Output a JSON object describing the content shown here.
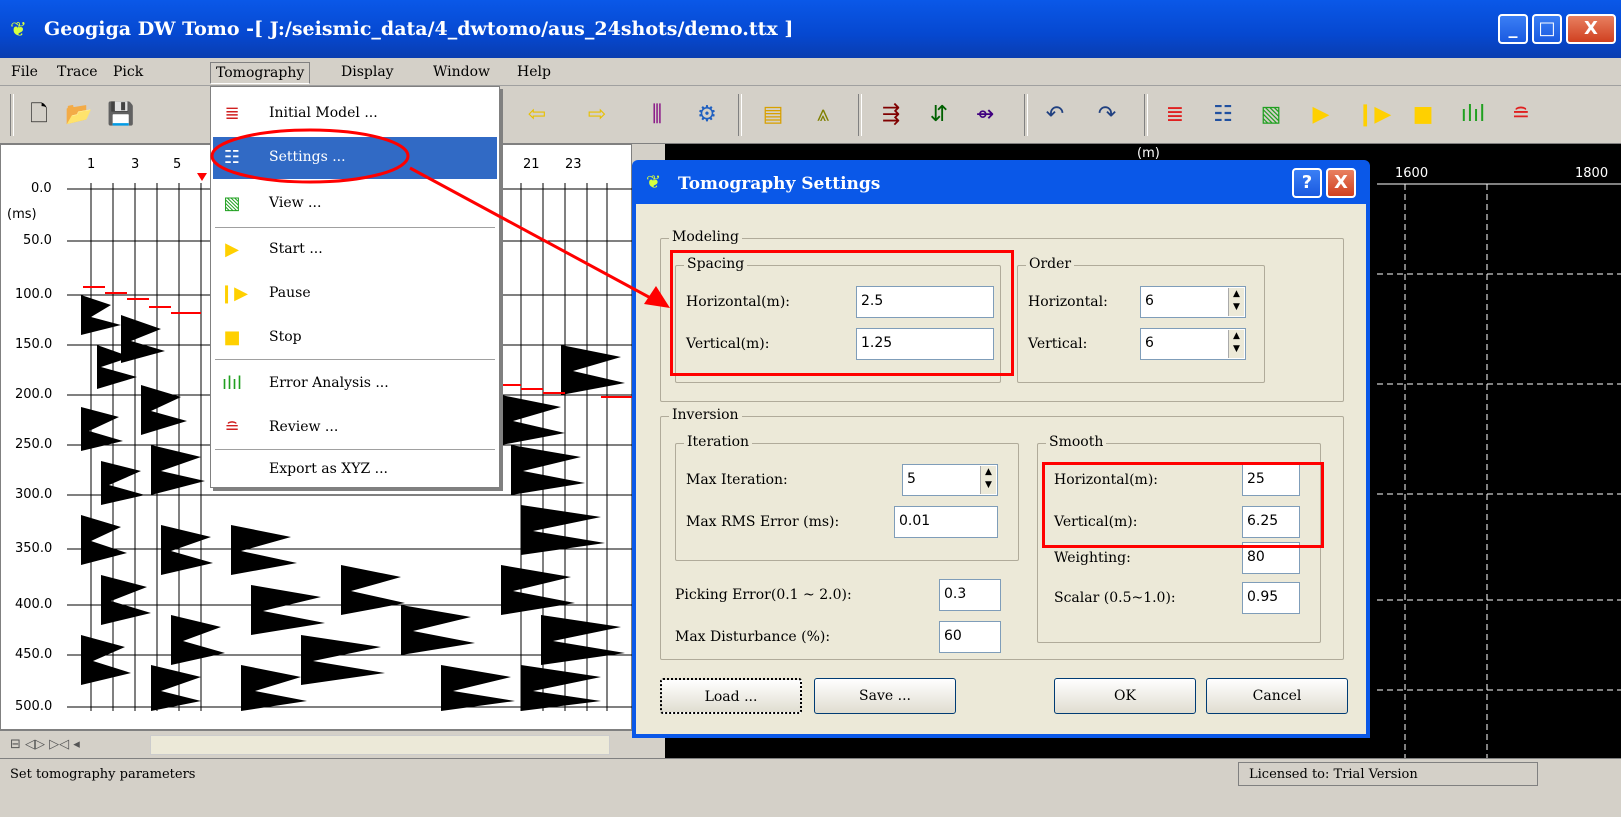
{
  "window": {
    "title": "Geogiga DW Tomo -[ J:/seismic_data/4_dwtomo/aus_24shots/demo.ttx ]",
    "minimize": "_",
    "maximize": "□",
    "close": "X"
  },
  "menubar": {
    "items": [
      "File",
      "Trace",
      "Pick",
      "Tomography",
      "Display",
      "Window",
      "Help"
    ]
  },
  "seismic": {
    "trace_numbers": [
      "1",
      "3",
      "5",
      "21",
      "23"
    ],
    "time_unit": "(ms)",
    "time_labels": [
      "0.0",
      "50.0",
      "100.0",
      "150.0",
      "200.0",
      "250.0",
      "300.0",
      "350.0",
      "400.0",
      "450.0",
      "500.0"
    ],
    "nav_controls": "⊟ ◁▷ ▷◁ ◂"
  },
  "right_panel": {
    "unit": "(m)",
    "x_labels": [
      "1600",
      "1800"
    ]
  },
  "tomography_menu": {
    "items": [
      {
        "label": "Initial Model ...",
        "icon": "initial-model-icon"
      },
      {
        "label": "Settings ...",
        "icon": "settings-icon"
      },
      {
        "label": "View ...",
        "icon": "view-icon"
      },
      {
        "label": "Start ...",
        "icon": "start-icon"
      },
      {
        "label": "Pause",
        "icon": "pause-icon"
      },
      {
        "label": "Stop",
        "icon": "stop-icon"
      },
      {
        "label": "Error Analysis ...",
        "icon": "error-analysis-icon"
      },
      {
        "label": "Review ...",
        "icon": "review-icon"
      },
      {
        "label": "Export as XYZ ...",
        "icon": ""
      }
    ]
  },
  "dialog": {
    "title": "Tomography Settings",
    "help": "?",
    "close": "X",
    "modeling": {
      "label": "Modeling",
      "spacing": {
        "label": "Spacing",
        "horizontal_label": "Horizontal(m):",
        "horizontal_value": "2.5",
        "vertical_label": "Vertical(m):",
        "vertical_value": "1.25"
      },
      "order": {
        "label": "Order",
        "horizontal_label": "Horizontal:",
        "horizontal_value": "6",
        "vertical_label": "Vertical:",
        "vertical_value": "6"
      }
    },
    "inversion": {
      "label": "Inversion",
      "iteration": {
        "label": "Iteration",
        "max_iteration_label": "Max Iteration:",
        "max_iteration_value": "5",
        "max_rms_label": "Max RMS Error (ms):",
        "max_rms_value": "0.01"
      },
      "picking_error_label": "Picking Error(0.1 ~ 2.0):",
      "picking_error_value": "0.3",
      "max_disturbance_label": "Max Disturbance (%):",
      "max_disturbance_value": "60",
      "smooth": {
        "label": "Smooth",
        "horizontal_label": "Horizontal(m):",
        "horizontal_value": "25",
        "vertical_label": "Vertical(m):",
        "vertical_value": "6.25",
        "weighting_label": "Weighting:",
        "weighting_value": "80",
        "scalar_label": "Scalar (0.5~1.0):",
        "scalar_value": "0.95"
      }
    },
    "buttons": {
      "load": "Load ...",
      "save": "Save ...",
      "ok": "OK",
      "cancel": "Cancel"
    }
  },
  "status": {
    "message": "Set tomography parameters",
    "license": "Licensed to: Trial Version"
  },
  "colors": {
    "titlebar": "#0a58e8",
    "highlight": "#316ac5",
    "annotation_red": "#ff0000"
  }
}
